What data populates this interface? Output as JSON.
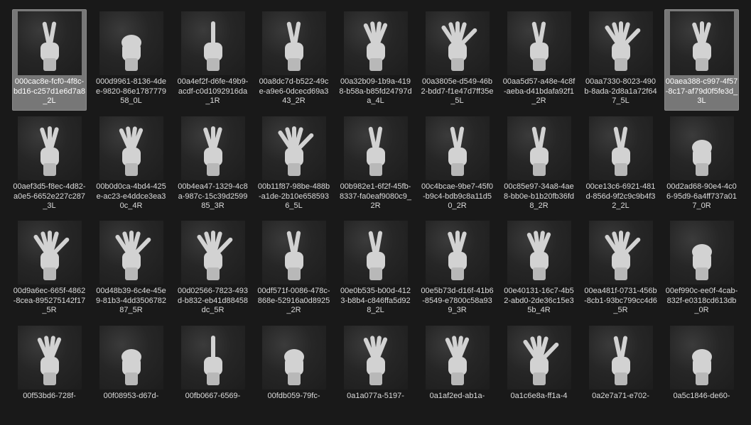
{
  "explorer": {
    "view": "large-icons",
    "files": [
      {
        "name": "000cac8e-fcf0-4f8c-bd16-c257d1e6d7a8_2L",
        "fingers": 2,
        "selected": true
      },
      {
        "name": "000d9961-8136-4dee-9820-86e178777958_0L",
        "fingers": 0,
        "selected": false
      },
      {
        "name": "00a4ef2f-d6fe-49b9-acdf-c0d1092916da_1R",
        "fingers": 1,
        "selected": false
      },
      {
        "name": "00a8dc7d-b522-49ce-a9e6-0dcecd69a343_2R",
        "fingers": 2,
        "selected": false
      },
      {
        "name": "00a32b09-1b9a-4198-b58a-b85fd24797da_4L",
        "fingers": 4,
        "selected": false
      },
      {
        "name": "00a3805e-d549-46b2-bdd7-f1e47d7ff35e_5L",
        "fingers": 5,
        "selected": false
      },
      {
        "name": "00aa5d57-a48e-4c8f-aeba-d41bdafa92f1_2R",
        "fingers": 2,
        "selected": false
      },
      {
        "name": "00aa7330-8023-490b-8ada-2d8a1a72f647_5L",
        "fingers": 5,
        "selected": false
      },
      {
        "name": "00aea388-c997-4f57-8c17-af79d0f5fe3d_3L",
        "fingers": 3,
        "selected": true
      },
      {
        "name": "00aef3d5-f8ec-4d82-a0e5-6652e227c287_3L",
        "fingers": 3,
        "selected": false
      },
      {
        "name": "00b0d0ca-4bd4-425e-ac23-e4ddce3ea30c_4R",
        "fingers": 4,
        "selected": false
      },
      {
        "name": "00b4ea47-1329-4c8a-987c-15c39d259985_3R",
        "fingers": 3,
        "selected": false
      },
      {
        "name": "00b11f87-98be-488b-a1de-2b10e6585936_5L",
        "fingers": 5,
        "selected": false
      },
      {
        "name": "00b982e1-6f2f-45fb-8337-fa0eaf9080c9_2R",
        "fingers": 2,
        "selected": false
      },
      {
        "name": "00c4bcae-9be7-45f0-b9c4-bdb9c8a11d50_2R",
        "fingers": 2,
        "selected": false
      },
      {
        "name": "00c85e97-34a8-4ae8-bb0e-b1b20fb36fd8_2R",
        "fingers": 2,
        "selected": false
      },
      {
        "name": "00ce13c6-6921-481d-856d-9f2c9c9b4f32_2L",
        "fingers": 2,
        "selected": false
      },
      {
        "name": "00d2ad68-90e4-4c06-95d9-6a4ff737a017_0R",
        "fingers": 0,
        "selected": false
      },
      {
        "name": "00d9a6ec-665f-4862-8cea-895275142f17_5R",
        "fingers": 5,
        "selected": false
      },
      {
        "name": "00d48b39-6c4e-45e9-81b3-4dd350678287_5R",
        "fingers": 5,
        "selected": false
      },
      {
        "name": "00d02566-7823-493d-b832-eb41d88458dc_5R",
        "fingers": 5,
        "selected": false
      },
      {
        "name": "00df571f-0086-478c-868e-52916a0d8925_2R",
        "fingers": 2,
        "selected": false
      },
      {
        "name": "00e0b535-b00d-4123-b8b4-c846ffa5d928_2L",
        "fingers": 2,
        "selected": false
      },
      {
        "name": "00e5b73d-d16f-41b6-8549-e7800c58a939_3R",
        "fingers": 3,
        "selected": false
      },
      {
        "name": "00e40131-16c7-4b52-abd0-2de36c15e35b_4R",
        "fingers": 4,
        "selected": false
      },
      {
        "name": "00ea481f-0731-456b-8cb1-93bc799cc4d6_5R",
        "fingers": 5,
        "selected": false
      },
      {
        "name": "00ef990c-ee0f-4cab-832f-e0318cd613db_0R",
        "fingers": 0,
        "selected": false
      },
      {
        "name": "00f53bd6-728f-",
        "fingers": 4,
        "selected": false
      },
      {
        "name": "00f08953-d67d-",
        "fingers": 0,
        "selected": false
      },
      {
        "name": "00fb0667-6569-",
        "fingers": 1,
        "selected": false
      },
      {
        "name": "00fdb059-79fc-",
        "fingers": 0,
        "selected": false
      },
      {
        "name": "0a1a077a-5197-",
        "fingers": 4,
        "selected": false
      },
      {
        "name": "0a1af2ed-ab1a-",
        "fingers": 4,
        "selected": false
      },
      {
        "name": "0a1c6e8a-ff1a-4",
        "fingers": 5,
        "selected": false
      },
      {
        "name": "0a2e7a71-e702-",
        "fingers": 2,
        "selected": false
      },
      {
        "name": "0a5c1846-de60-",
        "fingers": 0,
        "selected": false
      }
    ]
  }
}
